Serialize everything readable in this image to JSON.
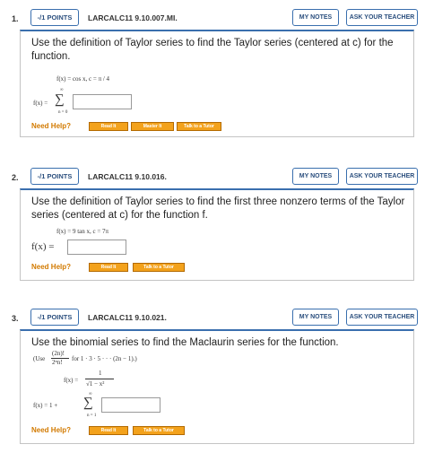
{
  "colors": {
    "accent": "#3a6fae",
    "help_orange": "#d27a00",
    "button_orange": "#f3a21c"
  },
  "questions": [
    {
      "number": "1.",
      "points": "-/1 POINTS",
      "code": "LARCALC11 9.10.007.MI.",
      "my_notes": "MY NOTES",
      "ask_teacher": "ASK YOUR TEACHER",
      "prompt": "Use the definition of Taylor series to find the Taylor series (centered at c) for the function.",
      "given": "f(x) = cos x,    c = π / 4",
      "answer_label": "f(x) =",
      "sum_top": "∞",
      "sum_bottom": "n = 0",
      "need_help": "Need Help?",
      "help_buttons": [
        "Read It",
        "Master It",
        "Talk to a Tutor"
      ]
    },
    {
      "number": "2.",
      "points": "-/1 POINTS",
      "code": "LARCALC11 9.10.016.",
      "my_notes": "MY NOTES",
      "ask_teacher": "ASK YOUR TEACHER",
      "prompt": "Use the definition of Taylor series to find the first three nonzero terms of the Taylor series (centered at c) for the function f.",
      "given": "f(x) = 9 tan x,  c = 7π",
      "answer_label": "f(x) =",
      "need_help": "Need Help?",
      "help_buttons": [
        "Read It",
        "Talk to a Tutor"
      ]
    },
    {
      "number": "3.",
      "points": "-/1 POINTS",
      "code": "LARCALC11 9.10.021.",
      "my_notes": "MY NOTES",
      "ask_teacher": "ASK YOUR TEACHER",
      "prompt": "Use the binomial series to find the Maclaurin series for the function.",
      "hint_pre": "(Use",
      "hint_num": "(2n)!",
      "hint_den": "2ⁿn!",
      "hint_post": "for 1 · 3 · 5 · · · (2n − 1).)",
      "func_label": "f(x) =",
      "func_num": "1",
      "func_den": "√1 − x²",
      "answer_label": "f(x) = 1 +",
      "sum_top": "∞",
      "sum_bottom": "n = 1",
      "need_help": "Need Help?",
      "help_buttons": [
        "Read It",
        "Talk to a Tutor"
      ]
    }
  ]
}
